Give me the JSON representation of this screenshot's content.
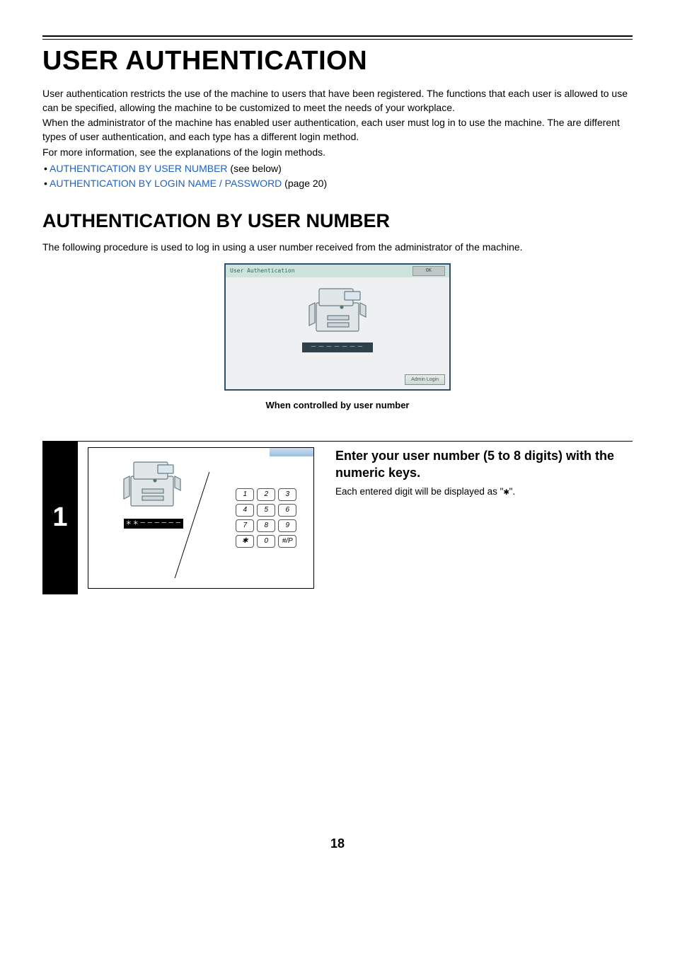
{
  "title": "USER AUTHENTICATION",
  "intro": {
    "p1": "User authentication restricts the use of the machine to users that have been registered. The functions that each user is allowed to use can be specified, allowing the machine to be customized to meet the needs of your workplace.",
    "p2": "When the administrator of the machine has enabled user authentication, each user must log in to use the machine. The are different types of user authentication, and each type has a different login method.",
    "p3": "For more information, see the explanations of the login methods."
  },
  "links": {
    "l1": "AUTHENTICATION BY USER NUMBER",
    "l1_suffix": " (see below)",
    "l2": "AUTHENTICATION BY LOGIN NAME / PASSWORD",
    "l2_suffix": " (page 20)"
  },
  "section_title": "AUTHENTICATION BY USER NUMBER",
  "section_lead": "The following procedure is used to log in using a user number received from the administrator of the machine.",
  "panel": {
    "header": "User Authentication",
    "ok": "OK",
    "mask": "－－－－－－－",
    "admin": "Admin Login",
    "caption": "When controlled by user number"
  },
  "step": {
    "num": "1",
    "mask2": "＊＊－－－－－－",
    "keys": [
      "1",
      "2",
      "3",
      "4",
      "5",
      "6",
      "7",
      "8",
      "9",
      "✱",
      "0",
      "#/P"
    ],
    "heading": "Enter your user number (5 to 8 digits) with the numeric keys.",
    "body_a": "Each entered digit will be displayed as \"",
    "body_b": "\"."
  },
  "page_number": "18"
}
